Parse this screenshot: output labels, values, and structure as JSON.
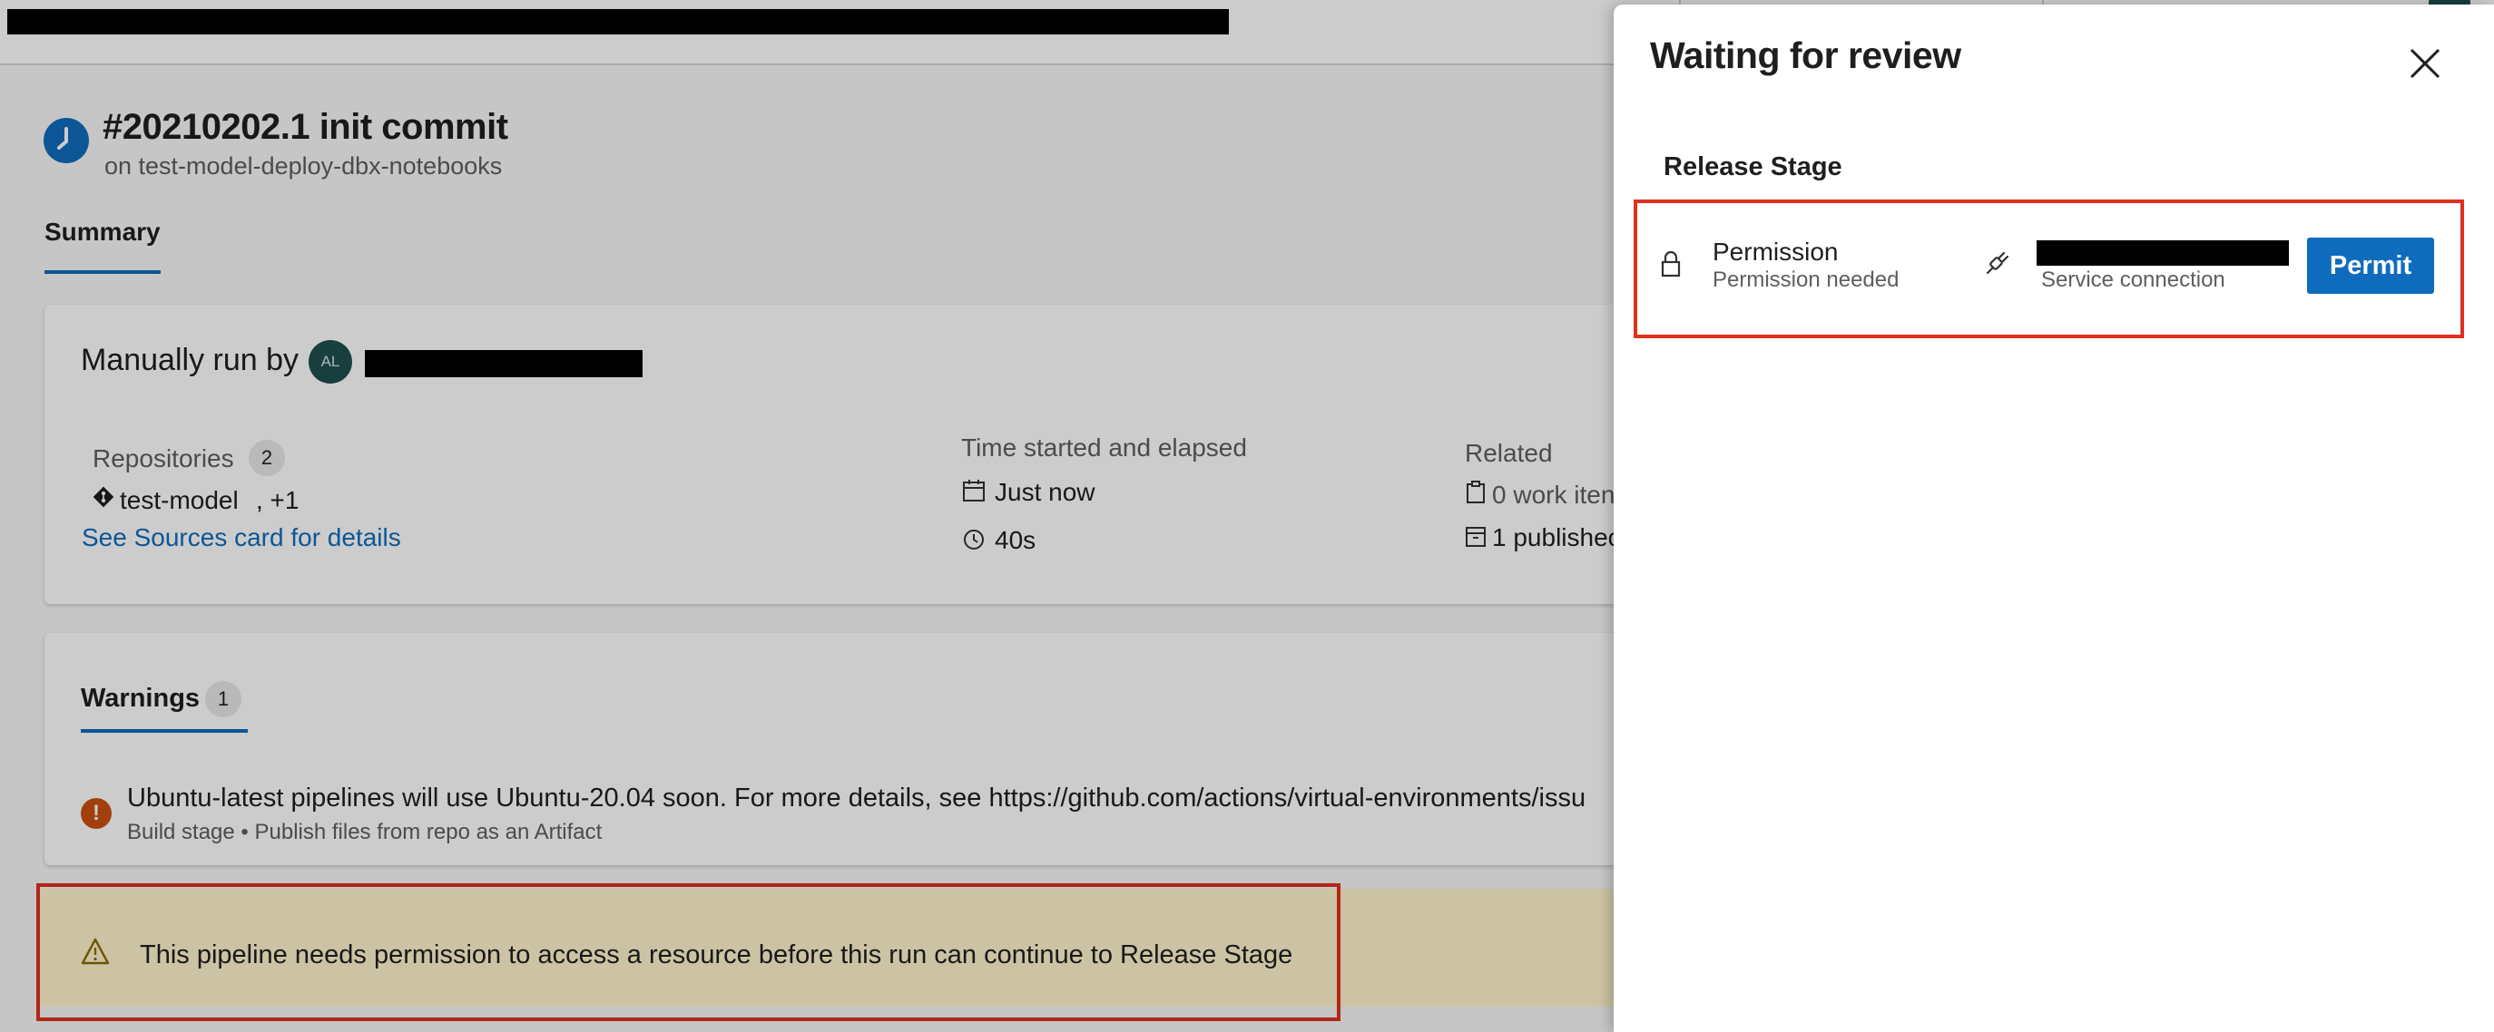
{
  "run": {
    "title": "#20210202.1 init commit",
    "branch": "on test-model-deploy-dbx-notebooks"
  },
  "tabs": {
    "summary": "Summary"
  },
  "summary_card": {
    "manually_run_label": "Manually run by",
    "avatar_initials": "AL",
    "repositories_label": "Repositories",
    "repositories_count": "2",
    "repo_name": "test-model",
    "repo_more": ", +1",
    "sources_link": "See Sources card for details",
    "time_label": "Time started and elapsed",
    "started": "Just now",
    "elapsed": "40s",
    "related_label": "Related",
    "work_items": "0 work iten",
    "published": "1 publishec"
  },
  "warnings": {
    "tab_label": "Warnings",
    "count": "1",
    "message": "Ubuntu-latest pipelines will use Ubuntu-20.04 soon. For more details, see https://github.com/actions/virtual-environments/issu",
    "source": "Build stage • Publish files from repo as an Artifact"
  },
  "banner": {
    "text": "This pipeline needs permission to access a resource before this run can continue to Release Stage"
  },
  "panel": {
    "title": "Waiting for review",
    "stage": "Release Stage",
    "check_title": "Permission",
    "check_status": "Permission needed",
    "resource_type": "Service connection",
    "permit_label": "Permit"
  },
  "icons": {
    "status": "clock-icon",
    "repo": "git-repo-icon",
    "calendar": "calendar-icon",
    "clock": "clock-icon",
    "work_item": "clipboard-icon",
    "artifact": "package-icon",
    "warning_item": "exclamation-circle-icon",
    "banner": "warning-triangle-icon",
    "close": "close-icon",
    "lock": "lock-icon",
    "service_connection": "plug-icon"
  },
  "colors": {
    "accent": "#0f6cbd",
    "warning_orange": "#ca5010",
    "highlight_red": "#e0301e",
    "banner_bg": "#fff4ce"
  }
}
